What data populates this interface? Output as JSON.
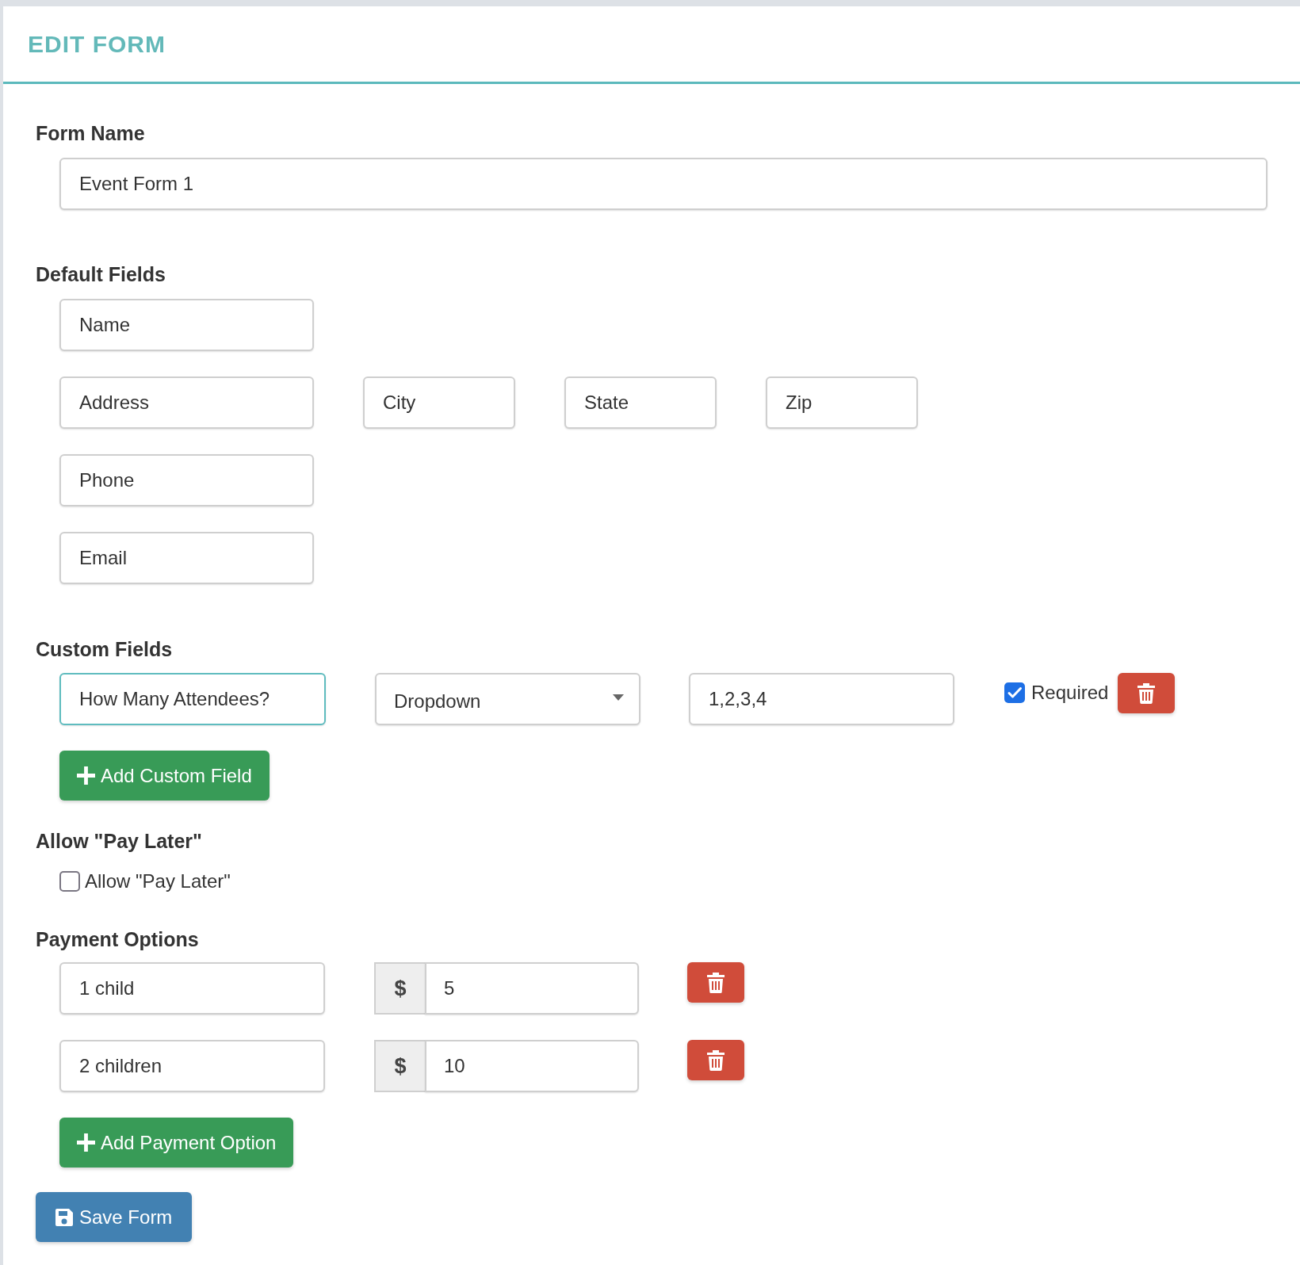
{
  "header": {
    "title": "EDIT FORM"
  },
  "form_name": {
    "label": "Form Name",
    "value": "Event Form 1"
  },
  "default_fields": {
    "label": "Default Fields",
    "rows": [
      [
        "Name"
      ],
      [
        "Address",
        "City",
        "State",
        "Zip"
      ],
      [
        "Phone"
      ],
      [
        "Email"
      ]
    ]
  },
  "custom_fields": {
    "label": "Custom Fields",
    "items": [
      {
        "name": "How Many Attendees?",
        "focused": true,
        "type": "Dropdown",
        "options": "1,2,3,4",
        "required": true,
        "required_label": "Required"
      }
    ],
    "add_button": "Add Custom Field"
  },
  "pay_later": {
    "label": "Allow \"Pay Later\"",
    "checkbox_label": "Allow \"Pay Later\"",
    "checked": false
  },
  "payment_options": {
    "label": "Payment Options",
    "items": [
      {
        "name": "1 child",
        "currency": "$",
        "amount": "5"
      },
      {
        "name": "2 children",
        "currency": "$",
        "amount": "10"
      }
    ],
    "add_button": "Add Payment Option"
  },
  "save_button": "Save Form"
}
